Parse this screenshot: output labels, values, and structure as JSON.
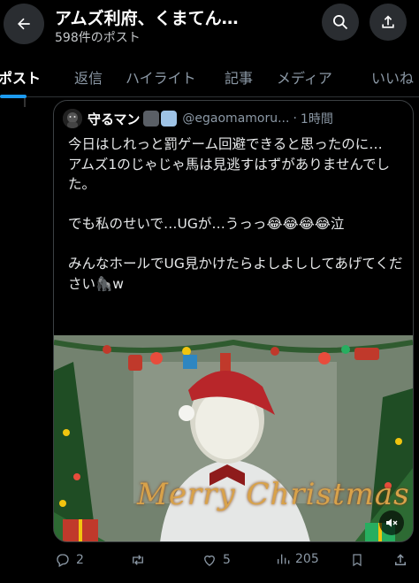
{
  "header": {
    "title": "アムズ利府、くまてん…",
    "subtitle": "598件のポスト",
    "back_icon": "arrow-left-icon",
    "search_icon": "search-icon",
    "share_icon": "share-icon"
  },
  "tabs": [
    {
      "label": "ポスト",
      "active": true
    },
    {
      "label": "返信"
    },
    {
      "label": "ハイライト"
    },
    {
      "label": "記事"
    },
    {
      "label": "メディア"
    },
    {
      "label": "いいね"
    }
  ],
  "quote": {
    "name": "守るマン",
    "handle": "@egaomamoru...",
    "separator": "·",
    "time": "1時間",
    "text": "今日はしれっと罰ゲーム回避できると思ったのに…\nアムズ1のじゃじゃ馬は見逃すはずがありませんでした。\n\nでも私のせいで…UGが…うっっ😂😂😂😂泣\n\nみんなホールでUG見かけたらよしよししてあげてください🦍w",
    "media_caption": "Merry Christmas"
  },
  "actions": {
    "replies": "2",
    "reposts": "",
    "likes": "5",
    "views": "205"
  },
  "colors": {
    "accent": "#1d9bf0",
    "background": "#000000",
    "muted": "#8b98a5"
  }
}
